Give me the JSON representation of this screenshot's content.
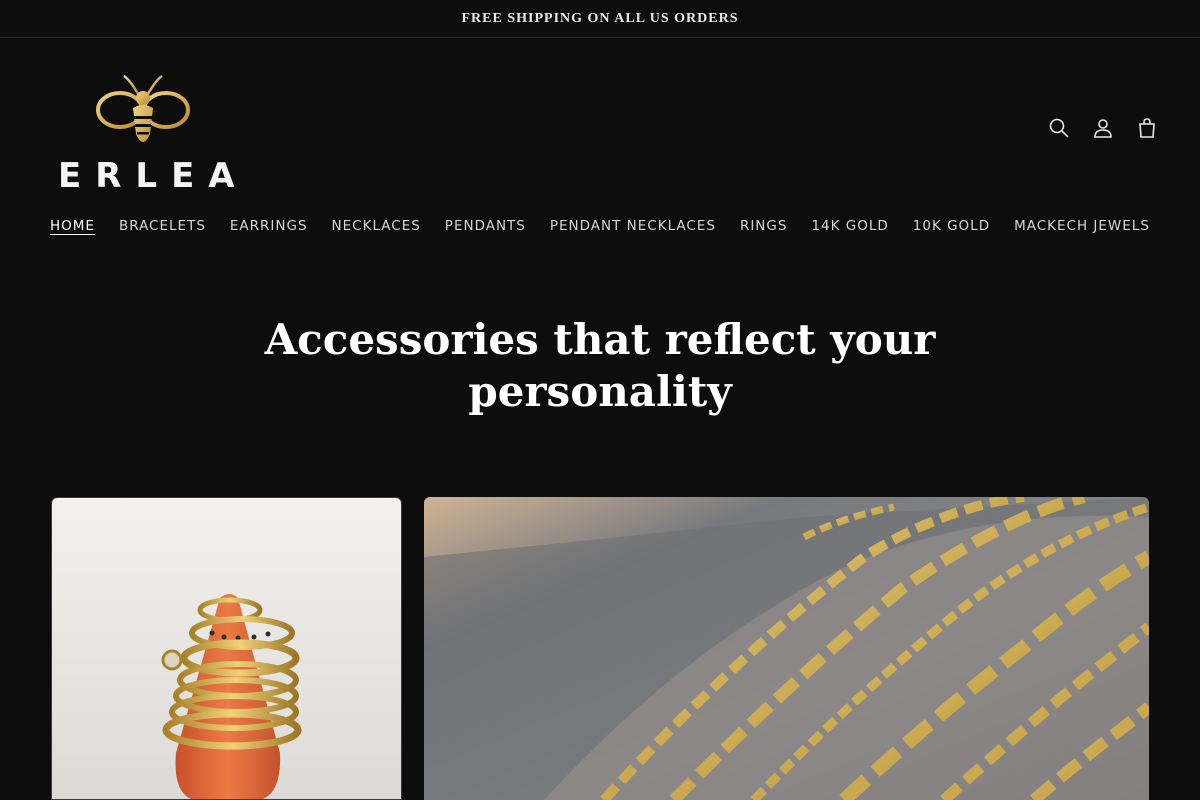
{
  "announcement": {
    "text": "FREE SHIPPING ON ALL US ORDERS"
  },
  "brand": {
    "name": "ERLEA",
    "logo_icon": "bee-icon",
    "accent": "#d9b45a"
  },
  "header": {
    "icons": [
      {
        "name": "search-icon",
        "label": "Search"
      },
      {
        "name": "account-icon",
        "label": "Log in"
      },
      {
        "name": "cart-icon",
        "label": "Cart"
      }
    ]
  },
  "nav": {
    "items": [
      {
        "label": "HOME",
        "active": true
      },
      {
        "label": "BRACELETS"
      },
      {
        "label": "EARRINGS"
      },
      {
        "label": "NECKLACES"
      },
      {
        "label": "PENDANTS"
      },
      {
        "label": "PENDANT NECKLACES"
      },
      {
        "label": "RINGS"
      },
      {
        "label": "14K GOLD"
      },
      {
        "label": "10K GOLD"
      },
      {
        "label": "MACKECH JEWELS"
      }
    ]
  },
  "hero": {
    "title": "Accessories that reflect your personality"
  },
  "colors": {
    "background": "#0d0d0d",
    "text": "#ffffff",
    "gold": "#d9b45a",
    "orange": "#e06a38"
  }
}
